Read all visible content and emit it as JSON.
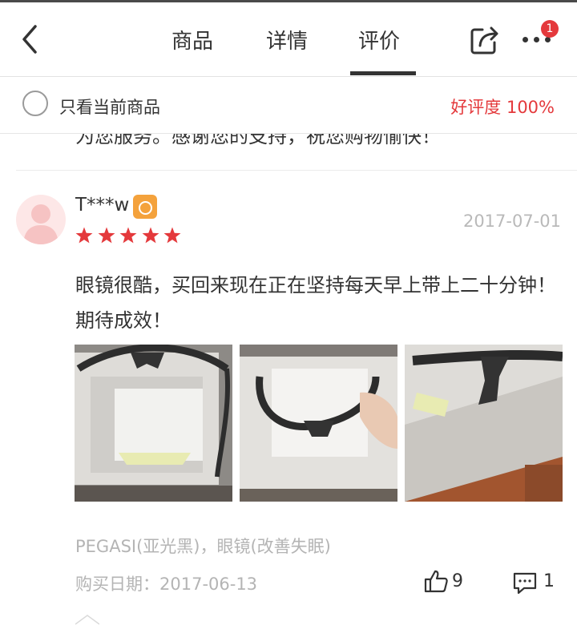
{
  "header": {
    "tabs": [
      {
        "label": "商品"
      },
      {
        "label": "详情"
      },
      {
        "label": "评价",
        "active": true
      }
    ],
    "more_badge": "1",
    "icons": {
      "back": "chevron-left-icon",
      "share": "share-icon",
      "more": "more-dots-icon"
    }
  },
  "filter": {
    "only_current_label": "只看当前商品",
    "positive_rate": "好评度 100%"
  },
  "previous_review": {
    "tail_text": "为您服务。感谢您的支持，祝您购物愉快！"
  },
  "review": {
    "username": "T***w",
    "date": "2017-07-01",
    "stars": 5,
    "content": "眼镜很酷，买回来现在正在坚持每天早上带上二十分钟！期待成效！",
    "photos": [
      "glasses-in-box-photo",
      "hand-holding-glasses-photo",
      "glasses-closeup-photo"
    ],
    "spec": "PEGASI(亚光黑)，眼镜(改善失眠)",
    "purchase_date": "购买日期：2017-06-13",
    "likes": "9",
    "comments": "1"
  },
  "colors": {
    "accent_red": "#e4393c",
    "muted_text": "#b4b4b4",
    "star_red": "#e4393c"
  }
}
